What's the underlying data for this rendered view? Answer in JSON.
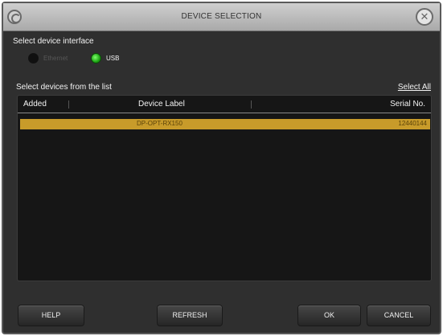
{
  "window": {
    "title": "DEVICE SELECTION"
  },
  "interface": {
    "label": "Select device interface",
    "options": [
      {
        "label": "Ethernet",
        "selected": false
      },
      {
        "label": "USB",
        "selected": true
      }
    ]
  },
  "devices": {
    "label": "Select devices from the list",
    "select_all": "Select All",
    "columns": {
      "added": "Added",
      "label": "Device Label",
      "serial": "Serial No."
    },
    "rows": [
      {
        "added": "",
        "label": "DP-OPT-RX150",
        "serial": "12440144"
      }
    ]
  },
  "buttons": {
    "help": "HELP",
    "refresh": "REFRESH",
    "ok": "OK",
    "cancel": "CANCEL"
  },
  "colors": {
    "selected_row": "#c89b2a",
    "usb_active": "#1ea515",
    "background": "#2f2f2f"
  },
  "icons": {
    "app": "app-logo-icon",
    "close": "close-icon"
  }
}
